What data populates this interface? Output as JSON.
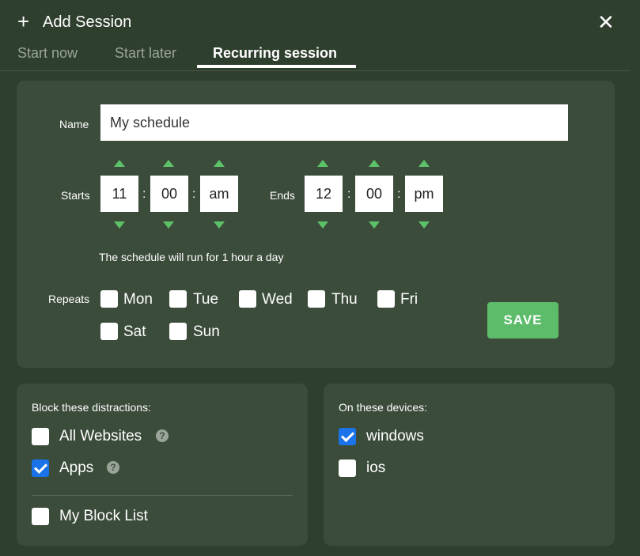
{
  "header": {
    "plus_icon": "+",
    "title": "Add Session",
    "close_icon": "✕"
  },
  "tabs": [
    {
      "label": "Start now"
    },
    {
      "label": "Start later"
    },
    {
      "label": "Recurring session",
      "active": true
    }
  ],
  "schedule": {
    "name_label": "Name",
    "name_value": "My schedule",
    "starts_label": "Starts",
    "ends_label": "Ends",
    "start": {
      "hour": "11",
      "minute": "00",
      "ampm": "am"
    },
    "end": {
      "hour": "12",
      "minute": "00",
      "ampm": "pm"
    },
    "separator": ":",
    "summary": "The schedule will run for 1 hour a day",
    "repeats_label": "Repeats",
    "days": [
      {
        "label": "Mon",
        "checked": false
      },
      {
        "label": "Tue",
        "checked": false
      },
      {
        "label": "Wed",
        "checked": false
      },
      {
        "label": "Thu",
        "checked": false
      },
      {
        "label": "Fri",
        "checked": false
      },
      {
        "label": "Sat",
        "checked": false
      },
      {
        "label": "Sun",
        "checked": false
      }
    ],
    "save_label": "SAVE"
  },
  "distractions": {
    "heading": "Block these distractions:",
    "items": [
      {
        "label": "All Websites",
        "checked": false
      },
      {
        "label": "Apps",
        "checked": true
      },
      {
        "label": "My Block List",
        "checked": false
      }
    ],
    "help_glyph": "?"
  },
  "devices": {
    "heading": "On these devices:",
    "items": [
      {
        "label": "windows",
        "checked": true
      },
      {
        "label": "ios",
        "checked": false
      }
    ]
  },
  "colors": {
    "background": "#2f3f2e",
    "card": "#3c4c3b",
    "accent_green": "#5cbc6a",
    "checkbox_checked": "#1a73e8",
    "muted_text": "#9aa59a"
  }
}
